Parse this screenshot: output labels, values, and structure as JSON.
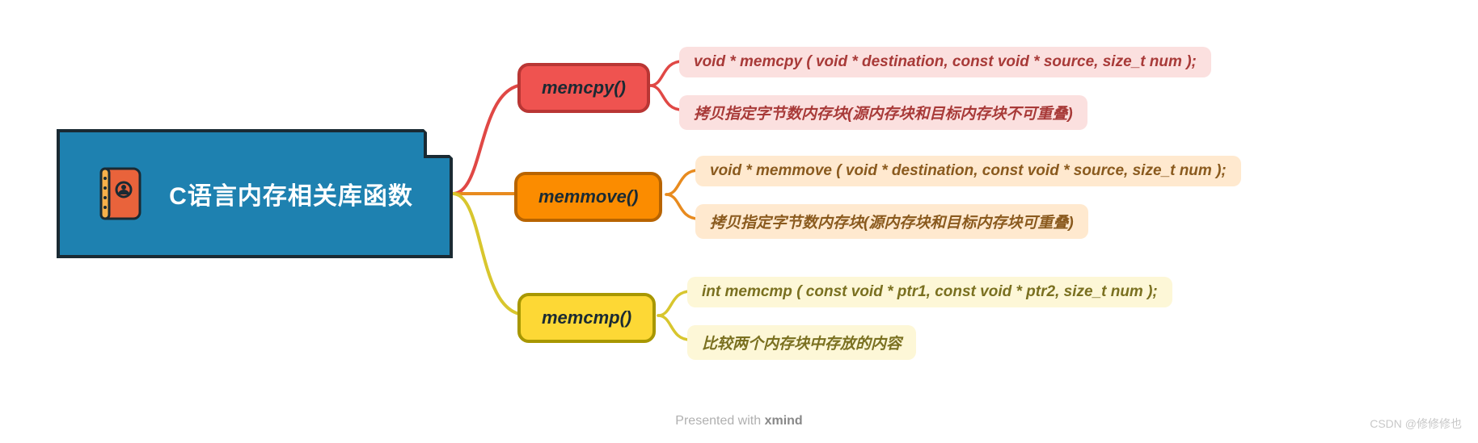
{
  "root": {
    "title": "C语言内存相关库函数"
  },
  "functions": [
    {
      "name": "memcpy()",
      "color": "red",
      "details": [
        "void * memcpy ( void * destination, const void * source, size_t num );",
        "拷贝指定字节数内存块(源内存块和目标内存块不可重叠)"
      ]
    },
    {
      "name": "memmove()",
      "color": "orange",
      "details": [
        "void * memmove ( void * destination, const void * source, size_t num );",
        "拷贝指定字节数内存块(源内存块和目标内存块可重叠)"
      ]
    },
    {
      "name": "memcmp()",
      "color": "yellow",
      "details": [
        "int memcmp ( const void * ptr1, const void * ptr2, size_t num );",
        "比较两个内存块中存放的内容"
      ]
    }
  ],
  "footer": {
    "prefix": "Presented with ",
    "brand": "xmind"
  },
  "watermark": "CSDN @修修修也"
}
